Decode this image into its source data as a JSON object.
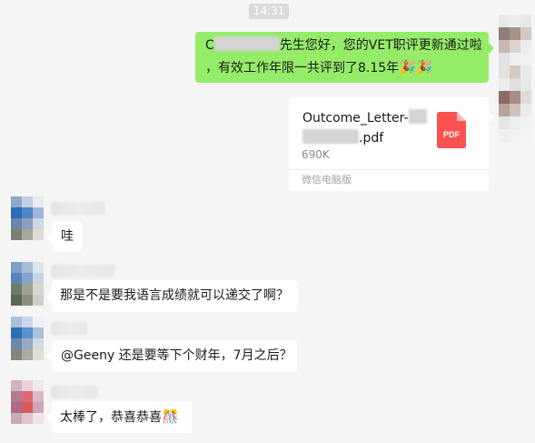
{
  "timestamp": "14:31",
  "outgoing": {
    "line1_start": "C",
    "line1_mid": "先生您好，您的VET职评更新通过啦",
    "line2": "，有效工作年限一共评到了8.15年",
    "emoji": "🎉🎉"
  },
  "file": {
    "name_line1": "Outcome_Letter-",
    "name_line2": ".pdf",
    "size": "690K",
    "source": "微信电脑版",
    "icon_label": "PDF"
  },
  "messages": [
    {
      "text": "哇"
    },
    {
      "text": "那是不是要我语言成绩就可以递交了啊？"
    },
    {
      "text": "@Geeny 还是要等下个财年，7月之后？"
    },
    {
      "text": "太棒了，恭喜恭喜",
      "emoji": "🎊"
    }
  ],
  "icons": {
    "pdf": "pdf-file-icon",
    "avatar": "avatar-icon"
  },
  "colors": {
    "outgoing_bubble": "#95ec69",
    "incoming_bubble": "#ffffff",
    "background": "#f5f5f5",
    "pdf_red": "#fa5151"
  }
}
